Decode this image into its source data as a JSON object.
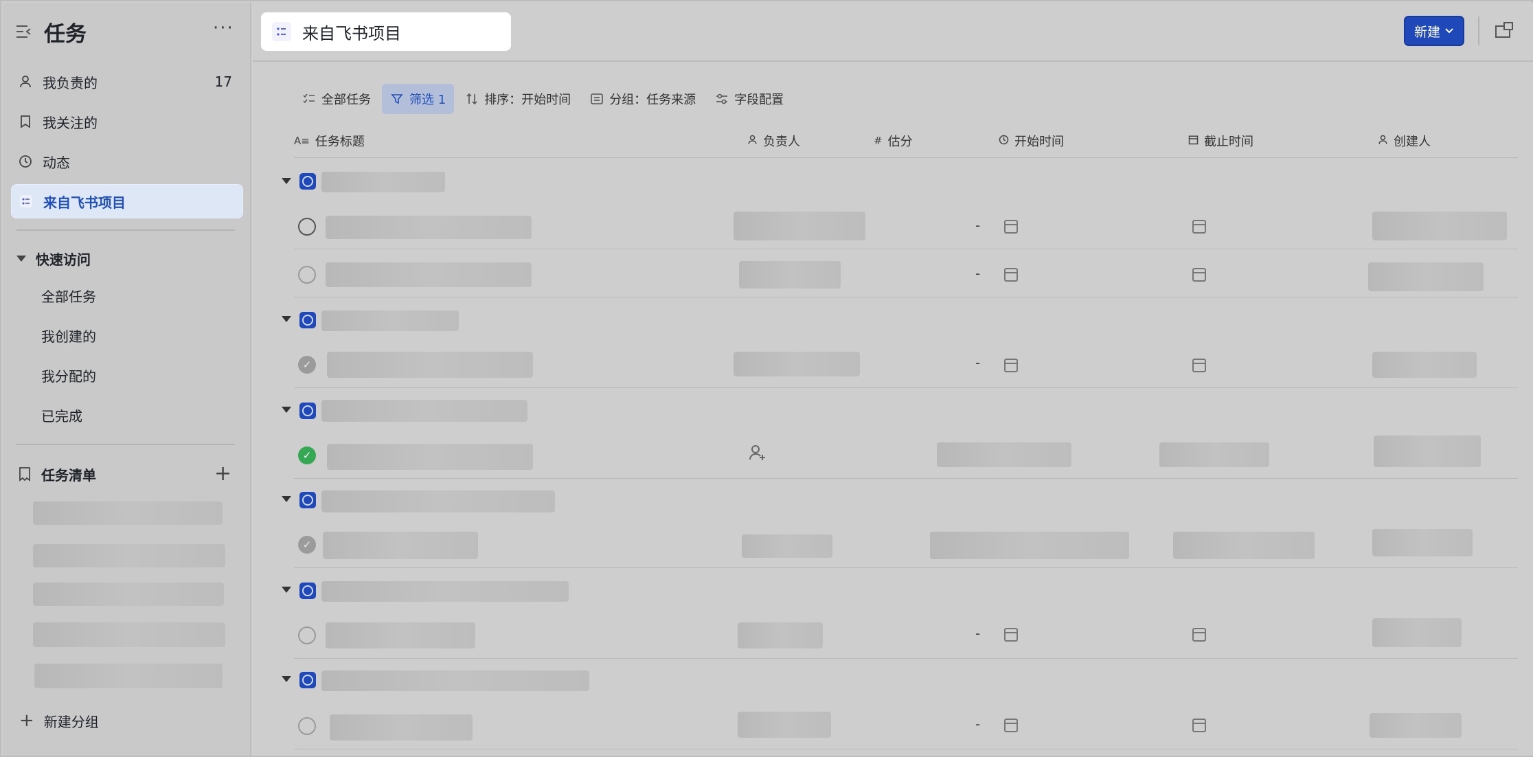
{
  "sidebar": {
    "title": "任务",
    "more": "···",
    "items": [
      {
        "label": "我负责的",
        "count": "17"
      },
      {
        "label": "我关注的"
      },
      {
        "label": "动态"
      },
      {
        "label": "来自飞书项目"
      }
    ],
    "quick_access": {
      "title": "快速访问",
      "items": [
        "全部任务",
        "我创建的",
        "我分配的",
        "已完成"
      ]
    },
    "task_lists": {
      "title": "任务清单",
      "add": "+"
    },
    "new_group": "新建分组"
  },
  "header": {
    "project_title": "来自飞书项目",
    "new_button": "新建"
  },
  "toolbar": {
    "all_tasks": "全部任务",
    "filter": "筛选 1",
    "sort": "排序：开始时间",
    "group": "分组：任务来源",
    "fields": "字段配置"
  },
  "columns": {
    "title": "任务标题",
    "assignee": "负责人",
    "estimate": "估分",
    "start_time": "开始时间",
    "due_time": "截止时间",
    "creator": "创建人"
  },
  "cells": {
    "empty": "-"
  },
  "colors": {
    "accent": "#1f48b8",
    "active_bg": "#dde7f6",
    "done_green": "#34a853"
  }
}
